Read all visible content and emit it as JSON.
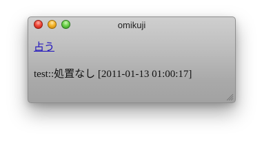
{
  "window": {
    "title": "omikuji"
  },
  "content": {
    "link_label": "占う",
    "result_text": "test::処置なし [2011-01-13 01:00:17]"
  },
  "icons": {
    "close": "close-button",
    "minimize": "minimize-button",
    "zoom": "zoom-button",
    "resize": "resize-grip-icon"
  },
  "colors": {
    "link": "#1a0dbd",
    "traffic_close": "#f04a3b",
    "traffic_minimize": "#f5b42a",
    "traffic_zoom": "#6fd34e"
  }
}
